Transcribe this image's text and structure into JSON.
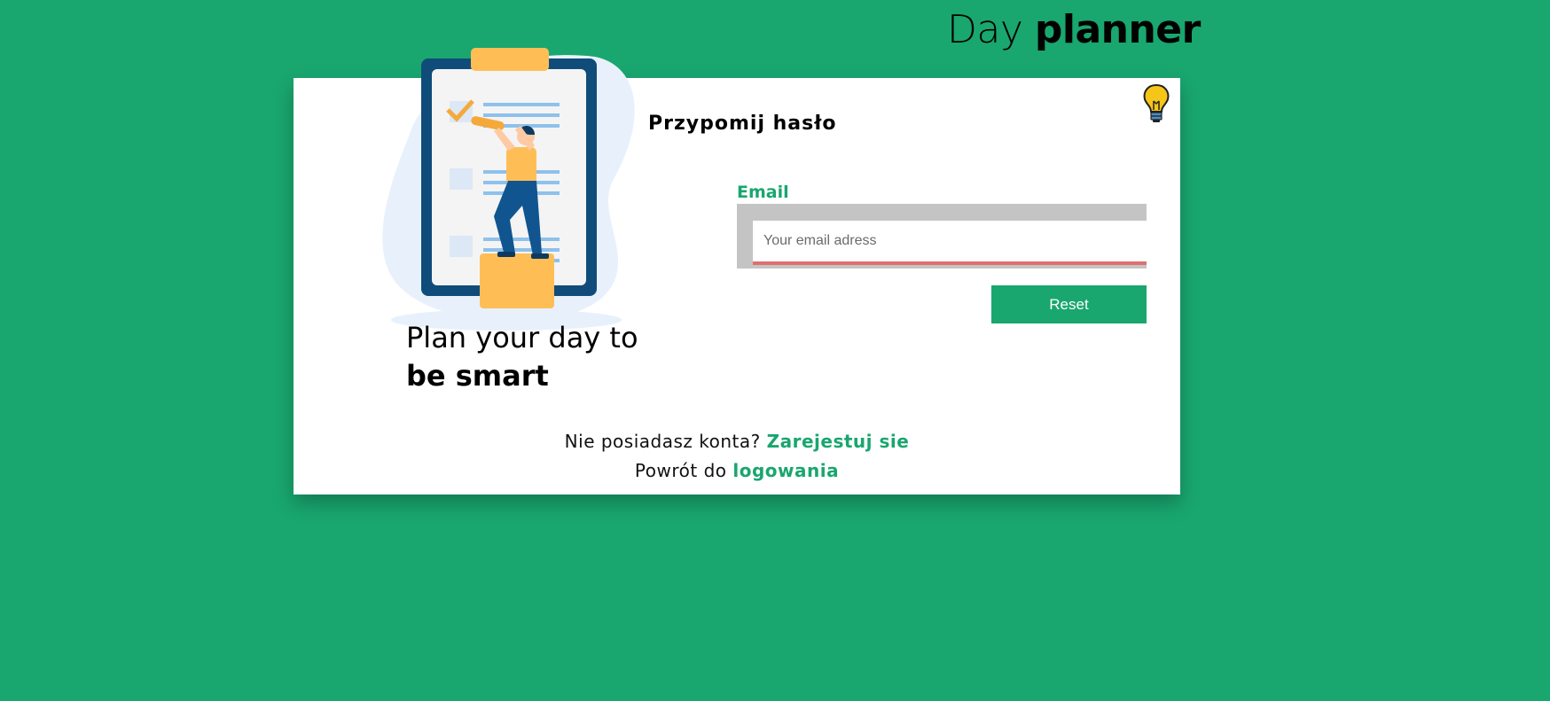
{
  "header": {
    "title_light": "Day",
    "title_bold": "planner"
  },
  "hero": {
    "tagline_line1": "Plan your day to",
    "tagline_line2": "be smart",
    "illustration": "person-checking-clipboard-illustration"
  },
  "theme_toggle": {
    "icon": "lightbulb-icon"
  },
  "form": {
    "title": "Przypomij hasło",
    "email_label": "Email",
    "email_value": "",
    "email_placeholder": "Your email adress",
    "reset_label": "Reset"
  },
  "footer": {
    "register_prompt": "Nie posiadasz konta?",
    "register_link": "Zarejestuj sie",
    "login_prompt": "Powrót do",
    "login_link": "logowania"
  },
  "colors": {
    "background": "#19a66f",
    "accent": "#19a66f",
    "input_error_border": "#e07070",
    "input_frame": "#c4c4c4"
  }
}
